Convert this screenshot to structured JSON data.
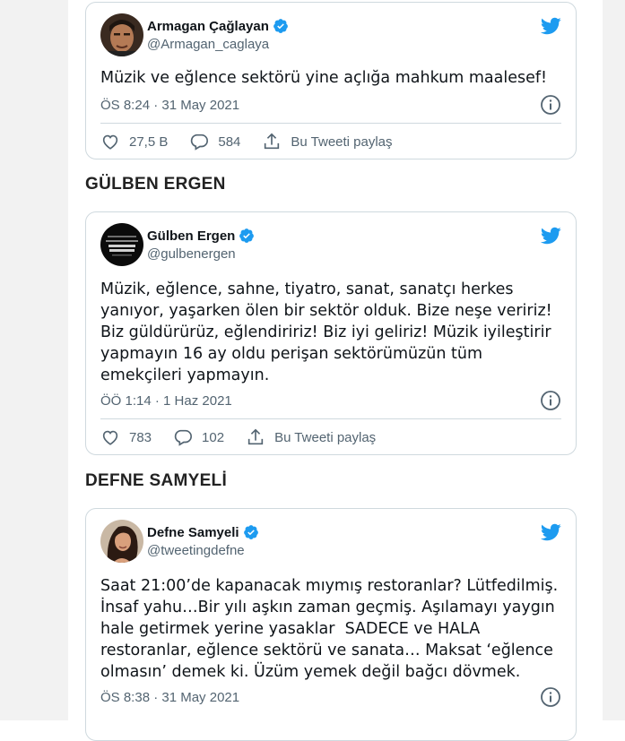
{
  "tweets": [
    {
      "author": "Armagan Çağlayan",
      "handle": "@Armagan_caglaya",
      "text": "Müzik ve eğlence sektörü yine açlığa mahkum maalesef!",
      "timestamp": "ÖS 8:24 · 31 May 2021",
      "likes": "27,5 B",
      "replies": "584",
      "share_label": "Bu Tweeti paylaş"
    },
    {
      "heading": "GÜLBEN ERGEN",
      "author": "Gülben Ergen",
      "handle": "@gulbenergen",
      "text": "Müzik, eğlence, sahne, tiyatro, sanat, sanatçı herkes\nyanıyor, yaşarken ölen bir sektör olduk. Bize neşe veririz!\nBiz güldürürüz, eğlendiririz! Biz iyi geliriz! Müzik iyileştirir\nyapmayın 16 ay oldu perişan sektörümüzün tüm\nemekçileri yapmayın.",
      "timestamp": "ÖÖ 1:14 · 1 Haz 2021",
      "likes": "783",
      "replies": "102",
      "share_label": "Bu Tweeti paylaş"
    },
    {
      "heading": "DEFNE SAMYELİ",
      "author": "Defne Samyeli",
      "handle": "@tweetingdefne",
      "text": "Saat 21:00’de kapanacak mıymış restoranlar? Lütfedilmiş.\nİnsaf yahu…Bir yılı aşkın zaman geçmiş. Aşılamayı yaygın\nhale getirmek yerine yasaklar  SADECE ve HALA\nrestoranlar, eğlence sektörü ve sanata… Maksat ‘eğlence\nolmasın’ demek ki. Üzüm yemek değil bağcı dövmek.",
      "timestamp": "ÖS 8:38 · 31 May 2021"
    }
  ],
  "colors": {
    "twitter_blue": "#1d9bf0",
    "muted_text": "#536471",
    "border": "#cfd9de"
  },
  "icons": {
    "brand": "twitter-bird-icon",
    "verified": "verified-badge-icon",
    "info": "info-icon",
    "like": "heart-icon",
    "reply": "reply-bubble-icon",
    "share": "share-icon"
  }
}
